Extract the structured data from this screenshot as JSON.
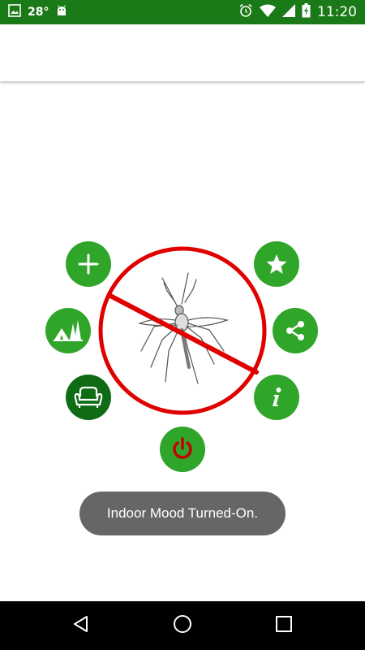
{
  "status_bar": {
    "temperature": "28°",
    "time": "11:20",
    "icons": [
      "image-icon",
      "android-icon",
      "alarm-icon",
      "wifi-icon",
      "signal-icon",
      "battery-charging-icon"
    ]
  },
  "main": {
    "emblem_icon": "no-mosquito-icon",
    "buttons": [
      {
        "name": "add-button",
        "icon": "plus-icon"
      },
      {
        "name": "outdoor-mode-button",
        "icon": "camping-tent-icon"
      },
      {
        "name": "indoor-mode-button",
        "icon": "armchair-icon",
        "active": true
      },
      {
        "name": "power-button",
        "icon": "power-icon"
      },
      {
        "name": "rate-button",
        "icon": "star-icon"
      },
      {
        "name": "share-button",
        "icon": "share-icon"
      },
      {
        "name": "info-button",
        "icon": "info-icon"
      }
    ],
    "colors": {
      "button": "#2fa52a",
      "button_active": "#0f6b14",
      "prohibit_red": "#e00000",
      "status_bar": "#1b7a18"
    }
  },
  "toast": {
    "message": "Indoor Mood Turned-On."
  },
  "nav_bar": {
    "icons": [
      "back-icon",
      "home-icon",
      "recents-icon"
    ]
  }
}
